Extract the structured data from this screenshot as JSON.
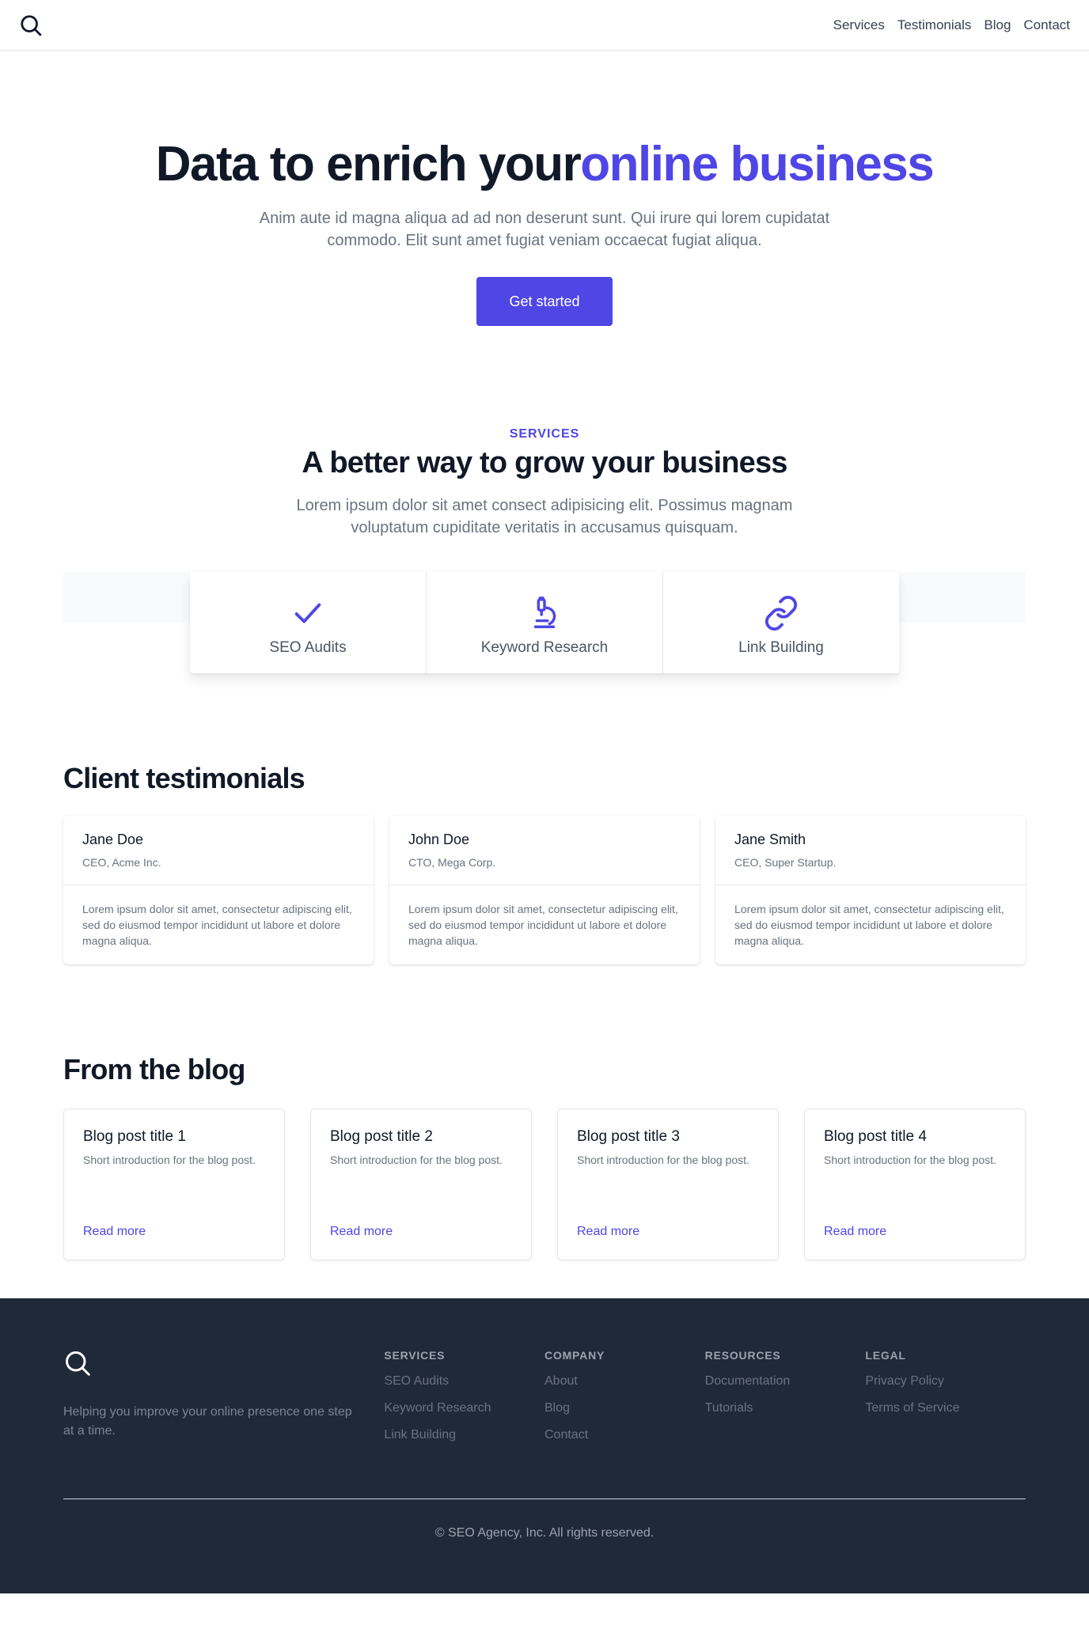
{
  "header": {
    "logo_icon": "search-icon",
    "nav": [
      {
        "label": "Services"
      },
      {
        "label": "Testimonials"
      },
      {
        "label": "Blog"
      },
      {
        "label": "Contact"
      }
    ]
  },
  "hero": {
    "title_main": "Data to enrich your",
    "title_accent": "online business",
    "subtitle": "Anim aute id magna aliqua ad ad non deserunt sunt. Qui irure qui lorem cupidatat commodo. Elit sunt amet fugiat veniam occaecat fugiat aliqua.",
    "cta": "Get started"
  },
  "services": {
    "eyebrow": "SERVICES",
    "title": "A better way to grow your business",
    "lead": "Lorem ipsum dolor sit amet consect adipisicing elit. Possimus magnam voluptatum cupiditate veritatis in accusamus quisquam.",
    "items": [
      {
        "label": "SEO Audits",
        "icon": "check-icon"
      },
      {
        "label": "Keyword Research",
        "icon": "microscope-icon"
      },
      {
        "label": "Link Building",
        "icon": "link-icon"
      }
    ]
  },
  "testimonials": {
    "title": "Client testimonials",
    "items": [
      {
        "name": "Jane Doe",
        "role": "CEO, Acme Inc.",
        "quote": "Lorem ipsum dolor sit amet, consectetur adipiscing elit, sed do eiusmod tempor incididunt ut labore et dolore magna aliqua."
      },
      {
        "name": "John Doe",
        "role": "CTO, Mega Corp.",
        "quote": "Lorem ipsum dolor sit amet, consectetur adipiscing elit, sed do eiusmod tempor incididunt ut labore et dolore magna aliqua."
      },
      {
        "name": "Jane Smith",
        "role": "CEO, Super Startup.",
        "quote": "Lorem ipsum dolor sit amet, consectetur adipiscing elit, sed do eiusmod tempor incididunt ut labore et dolore magna aliqua."
      }
    ]
  },
  "blog": {
    "title": "From the blog",
    "posts": [
      {
        "title": "Blog post title 1",
        "intro": "Short introduction for the blog post.",
        "link": "Read more"
      },
      {
        "title": "Blog post title 2",
        "intro": "Short introduction for the blog post.",
        "link": "Read more"
      },
      {
        "title": "Blog post title 3",
        "intro": "Short introduction for the blog post.",
        "link": "Read more"
      },
      {
        "title": "Blog post title 4",
        "intro": "Short introduction for the blog post.",
        "link": "Read more"
      }
    ]
  },
  "footer": {
    "logo_icon": "search-icon",
    "tagline": "Helping you improve your online presence one step at a time.",
    "columns": [
      {
        "heading": "SERVICES",
        "links": [
          "SEO Audits",
          "Keyword Research",
          "Link Building"
        ]
      },
      {
        "heading": "COMPANY",
        "links": [
          "About",
          "Blog",
          "Contact"
        ]
      },
      {
        "heading": "RESOURCES",
        "links": [
          "Documentation",
          "Tutorials"
        ]
      },
      {
        "heading": "LEGAL",
        "links": [
          "Privacy Policy",
          "Terms of Service"
        ]
      }
    ],
    "copyright": "© SEO Agency, Inc. All rights reserved."
  },
  "colors": {
    "accent": "#4f46e5",
    "footer_bg": "#1f2937",
    "text_dark": "#111827",
    "text_muted": "#6b7280"
  }
}
